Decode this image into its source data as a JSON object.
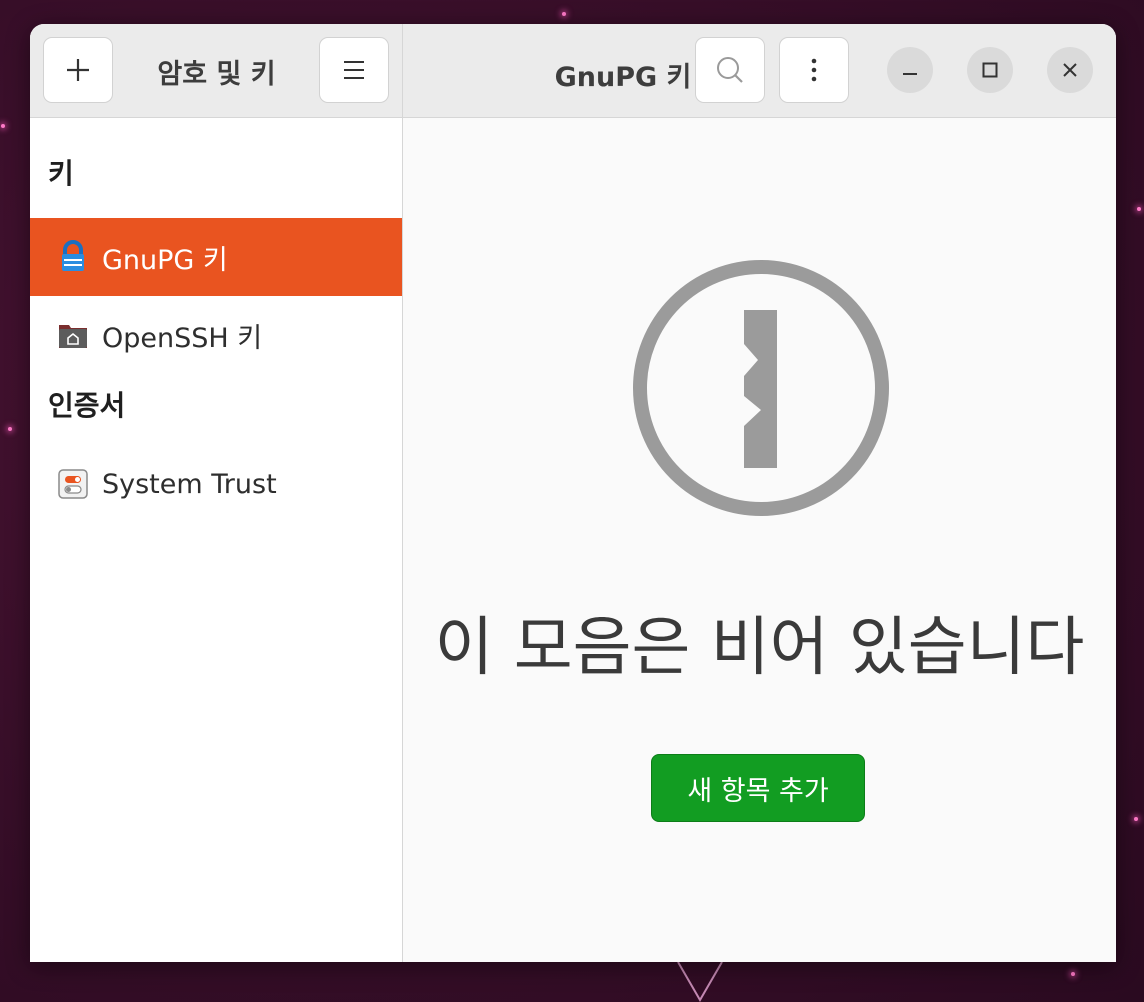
{
  "colors": {
    "accent": "#e95420",
    "success": "#129d22",
    "wallpaper": "#3a0f2a"
  },
  "header": {
    "sidebar_title": "암호 및 키",
    "main_title": "GnuPG 키",
    "buttons": {
      "add_icon": "plus-icon",
      "menu_icon": "hamburger-icon",
      "search_icon": "search-icon",
      "more_icon": "vertical-ellipsis-icon",
      "minimize_icon": "minimize-icon",
      "maximize_icon": "maximize-icon",
      "close_icon": "close-icon"
    }
  },
  "sidebar": {
    "sections": [
      {
        "title": "키",
        "items": [
          {
            "label": "GnuPG 키",
            "icon": "gnupg-icon",
            "selected": true
          },
          {
            "label": "OpenSSH 키",
            "icon": "openssh-folder-icon",
            "selected": false
          }
        ]
      },
      {
        "title": "인증서",
        "items": [
          {
            "label": "System Trust",
            "icon": "system-trust-icon",
            "selected": false
          }
        ]
      }
    ]
  },
  "main": {
    "empty_icon": "key-circle-icon",
    "empty_message": "이 모음은 비어 있습니다",
    "add_button_label": "새 항목 추가"
  }
}
